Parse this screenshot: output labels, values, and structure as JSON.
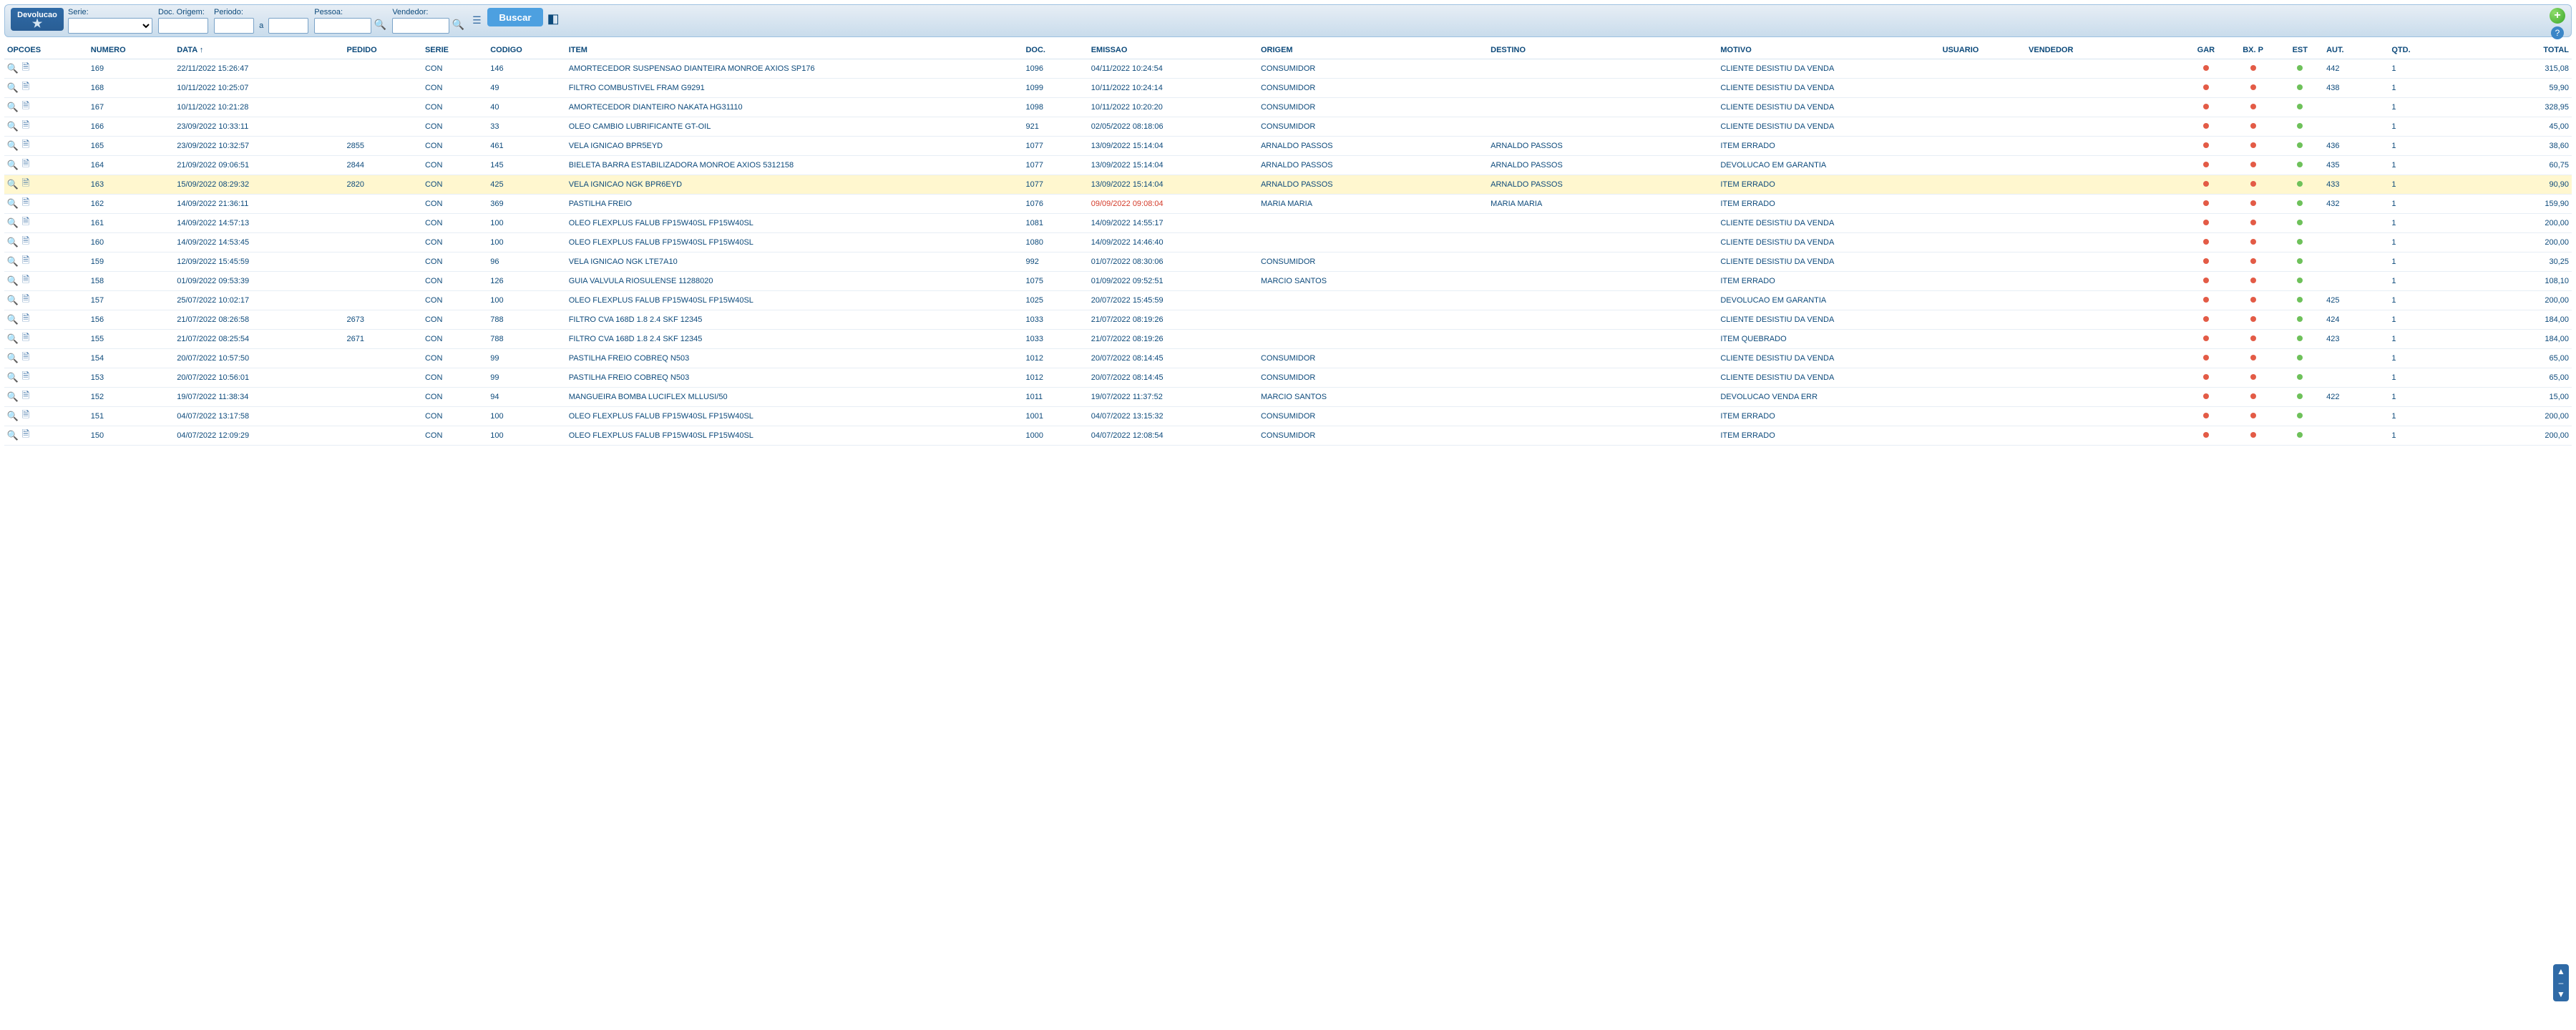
{
  "module": {
    "title": "Devolucao"
  },
  "filters": {
    "serie_label": "Serie:",
    "doc_origem_label": "Doc. Origem:",
    "periodo_label": "Periodo:",
    "periodo_sep": "a",
    "pessoa_label": "Pessoa:",
    "vendedor_label": "Vendedor:",
    "buscar_label": "Buscar"
  },
  "columns": {
    "opcoes": "OPCOES",
    "numero": "NUMERO",
    "data": "DATA ↑",
    "pedido": "PEDIDO",
    "serie": "SERIE",
    "codigo": "CODIGO",
    "item": "ITEM",
    "doc": "DOC.",
    "emissao": "EMISSAO",
    "origem": "ORIGEM",
    "destino": "DESTINO",
    "motivo": "MOTIVO",
    "usuario": "USUARIO",
    "vendedor": "VENDEDOR",
    "gar": "GAR",
    "bxp": "BX. P",
    "est": "EST",
    "aut": "AUT.",
    "qtd": "QTD.",
    "total": "TOTAL"
  },
  "rows": [
    {
      "numero": "169",
      "data": "22/11/2022 15:26:47",
      "pedido": "",
      "serie": "CON",
      "codigo": "146",
      "item": "AMORTECEDOR SUSPENSAO DIANTEIRA MONROE AXIOS SP176",
      "doc": "1096",
      "emissao": "04/11/2022 10:24:54",
      "origem": "CONSUMIDOR",
      "destino": "",
      "motivo": "CLIENTE DESISTIU DA VENDA",
      "aut": "442",
      "qtd": "1",
      "total": "315,08",
      "emissao_red": false,
      "sel": false
    },
    {
      "numero": "168",
      "data": "10/11/2022 10:25:07",
      "pedido": "",
      "serie": "CON",
      "codigo": "49",
      "item": "FILTRO COMBUSTIVEL FRAM G9291",
      "doc": "1099",
      "emissao": "10/11/2022 10:24:14",
      "origem": "CONSUMIDOR",
      "destino": "",
      "motivo": "CLIENTE DESISTIU DA VENDA",
      "aut": "438",
      "qtd": "1",
      "total": "59,90",
      "emissao_red": false,
      "sel": false
    },
    {
      "numero": "167",
      "data": "10/11/2022 10:21:28",
      "pedido": "",
      "serie": "CON",
      "codigo": "40",
      "item": "AMORTECEDOR DIANTEIRO NAKATA HG31110",
      "doc": "1098",
      "emissao": "10/11/2022 10:20:20",
      "origem": "CONSUMIDOR",
      "destino": "",
      "motivo": "CLIENTE DESISTIU DA VENDA",
      "aut": "",
      "qtd": "1",
      "total": "328,95",
      "emissao_red": false,
      "sel": false
    },
    {
      "numero": "166",
      "data": "23/09/2022 10:33:11",
      "pedido": "",
      "serie": "CON",
      "codigo": "33",
      "item": "OLEO CAMBIO LUBRIFICANTE GT-OIL",
      "doc": "921",
      "emissao": "02/05/2022 08:18:06",
      "origem": "CONSUMIDOR",
      "destino": "",
      "motivo": "CLIENTE DESISTIU DA VENDA",
      "aut": "",
      "qtd": "1",
      "total": "45,00",
      "emissao_red": false,
      "sel": false
    },
    {
      "numero": "165",
      "data": "23/09/2022 10:32:57",
      "pedido": "2855",
      "serie": "CON",
      "codigo": "461",
      "item": "VELA IGNICAO BPR5EYD",
      "doc": "1077",
      "emissao": "13/09/2022 15:14:04",
      "origem": "ARNALDO PASSOS",
      "destino": "ARNALDO PASSOS",
      "motivo": "ITEM ERRADO",
      "aut": "436",
      "qtd": "1",
      "total": "38,60",
      "emissao_red": false,
      "sel": false
    },
    {
      "numero": "164",
      "data": "21/09/2022 09:06:51",
      "pedido": "2844",
      "serie": "CON",
      "codigo": "145",
      "item": "BIELETA BARRA ESTABILIZADORA MONROE AXIOS 5312158",
      "doc": "1077",
      "emissao": "13/09/2022 15:14:04",
      "origem": "ARNALDO PASSOS",
      "destino": "ARNALDO PASSOS",
      "motivo": "DEVOLUCAO EM GARANTIA",
      "aut": "435",
      "qtd": "1",
      "total": "60,75",
      "emissao_red": false,
      "sel": false
    },
    {
      "numero": "163",
      "data": "15/09/2022 08:29:32",
      "pedido": "2820",
      "serie": "CON",
      "codigo": "425",
      "item": "VELA IGNICAO NGK BPR6EYD",
      "doc": "1077",
      "emissao": "13/09/2022 15:14:04",
      "origem": "ARNALDO PASSOS",
      "destino": "ARNALDO PASSOS",
      "motivo": "ITEM ERRADO",
      "aut": "433",
      "qtd": "1",
      "total": "90,90",
      "emissao_red": false,
      "sel": true
    },
    {
      "numero": "162",
      "data": "14/09/2022 21:36:11",
      "pedido": "",
      "serie": "CON",
      "codigo": "369",
      "item": "PASTILHA FREIO",
      "doc": "1076",
      "emissao": "09/09/2022 09:08:04",
      "origem": "MARIA MARIA",
      "destino": "MARIA MARIA",
      "motivo": "ITEM ERRADO",
      "aut": "432",
      "qtd": "1",
      "total": "159,90",
      "emissao_red": true,
      "sel": false
    },
    {
      "numero": "161",
      "data": "14/09/2022 14:57:13",
      "pedido": "",
      "serie": "CON",
      "codigo": "100",
      "item": "OLEO FLEXPLUS FALUB FP15W40SL FP15W40SL",
      "doc": "1081",
      "emissao": "14/09/2022 14:55:17",
      "origem": "",
      "destino": "",
      "motivo": "CLIENTE DESISTIU DA VENDA",
      "aut": "",
      "qtd": "1",
      "total": "200,00",
      "emissao_red": false,
      "sel": false
    },
    {
      "numero": "160",
      "data": "14/09/2022 14:53:45",
      "pedido": "",
      "serie": "CON",
      "codigo": "100",
      "item": "OLEO FLEXPLUS FALUB FP15W40SL FP15W40SL",
      "doc": "1080",
      "emissao": "14/09/2022 14:46:40",
      "origem": "",
      "destino": "",
      "motivo": "CLIENTE DESISTIU DA VENDA",
      "aut": "",
      "qtd": "1",
      "total": "200,00",
      "emissao_red": false,
      "sel": false
    },
    {
      "numero": "159",
      "data": "12/09/2022 15:45:59",
      "pedido": "",
      "serie": "CON",
      "codigo": "96",
      "item": "VELA IGNICAO NGK LTE7A10",
      "doc": "992",
      "emissao": "01/07/2022 08:30:06",
      "origem": "CONSUMIDOR",
      "destino": "",
      "motivo": "CLIENTE DESISTIU DA VENDA",
      "aut": "",
      "qtd": "1",
      "total": "30,25",
      "emissao_red": false,
      "sel": false
    },
    {
      "numero": "158",
      "data": "01/09/2022 09:53:39",
      "pedido": "",
      "serie": "CON",
      "codigo": "126",
      "item": "GUIA VALVULA RIOSULENSE 11288020",
      "doc": "1075",
      "emissao": "01/09/2022 09:52:51",
      "origem": "MARCIO SANTOS",
      "destino": "",
      "motivo": "ITEM ERRADO",
      "aut": "",
      "qtd": "1",
      "total": "108,10",
      "emissao_red": false,
      "sel": false
    },
    {
      "numero": "157",
      "data": "25/07/2022 10:02:17",
      "pedido": "",
      "serie": "CON",
      "codigo": "100",
      "item": "OLEO FLEXPLUS FALUB FP15W40SL FP15W40SL",
      "doc": "1025",
      "emissao": "20/07/2022 15:45:59",
      "origem": "",
      "destino": "",
      "motivo": "DEVOLUCAO EM GARANTIA",
      "aut": "425",
      "qtd": "1",
      "total": "200,00",
      "emissao_red": false,
      "sel": false
    },
    {
      "numero": "156",
      "data": "21/07/2022 08:26:58",
      "pedido": "2673",
      "serie": "CON",
      "codigo": "788",
      "item": "FILTRO CVA 168D 1.8 2.4 SKF 12345",
      "doc": "1033",
      "emissao": "21/07/2022 08:19:26",
      "origem": "",
      "destino": "",
      "motivo": "CLIENTE DESISTIU DA VENDA",
      "aut": "424",
      "qtd": "1",
      "total": "184,00",
      "emissao_red": false,
      "sel": false
    },
    {
      "numero": "155",
      "data": "21/07/2022 08:25:54",
      "pedido": "2671",
      "serie": "CON",
      "codigo": "788",
      "item": "FILTRO CVA 168D 1.8 2.4 SKF 12345",
      "doc": "1033",
      "emissao": "21/07/2022 08:19:26",
      "origem": "",
      "destino": "",
      "motivo": "ITEM QUEBRADO",
      "aut": "423",
      "qtd": "1",
      "total": "184,00",
      "emissao_red": false,
      "sel": false
    },
    {
      "numero": "154",
      "data": "20/07/2022 10:57:50",
      "pedido": "",
      "serie": "CON",
      "codigo": "99",
      "item": "PASTILHA FREIO COBREQ N503",
      "doc": "1012",
      "emissao": "20/07/2022 08:14:45",
      "origem": "CONSUMIDOR",
      "destino": "",
      "motivo": "CLIENTE DESISTIU DA VENDA",
      "aut": "",
      "qtd": "1",
      "total": "65,00",
      "emissao_red": false,
      "sel": false
    },
    {
      "numero": "153",
      "data": "20/07/2022 10:56:01",
      "pedido": "",
      "serie": "CON",
      "codigo": "99",
      "item": "PASTILHA FREIO COBREQ N503",
      "doc": "1012",
      "emissao": "20/07/2022 08:14:45",
      "origem": "CONSUMIDOR",
      "destino": "",
      "motivo": "CLIENTE DESISTIU DA VENDA",
      "aut": "",
      "qtd": "1",
      "total": "65,00",
      "emissao_red": false,
      "sel": false
    },
    {
      "numero": "152",
      "data": "19/07/2022 11:38:34",
      "pedido": "",
      "serie": "CON",
      "codigo": "94",
      "item": "MANGUEIRA BOMBA LUCIFLEX MLLUSI/50",
      "doc": "1011",
      "emissao": "19/07/2022 11:37:52",
      "origem": "MARCIO SANTOS",
      "destino": "",
      "motivo": "DEVOLUCAO VENDA ERR",
      "aut": "422",
      "qtd": "1",
      "total": "15,00",
      "emissao_red": false,
      "sel": false
    },
    {
      "numero": "151",
      "data": "04/07/2022 13:17:58",
      "pedido": "",
      "serie": "CON",
      "codigo": "100",
      "item": "OLEO FLEXPLUS FALUB FP15W40SL FP15W40SL",
      "doc": "1001",
      "emissao": "04/07/2022 13:15:32",
      "origem": "CONSUMIDOR",
      "destino": "",
      "motivo": "ITEM ERRADO",
      "aut": "",
      "qtd": "1",
      "total": "200,00",
      "emissao_red": false,
      "sel": false
    },
    {
      "numero": "150",
      "data": "04/07/2022 12:09:29",
      "pedido": "",
      "serie": "CON",
      "codigo": "100",
      "item": "OLEO FLEXPLUS FALUB FP15W40SL FP15W40SL",
      "doc": "1000",
      "emissao": "04/07/2022 12:08:54",
      "origem": "CONSUMIDOR",
      "destino": "",
      "motivo": "ITEM ERRADO",
      "aut": "",
      "qtd": "1",
      "total": "200,00",
      "emissao_red": false,
      "sel": false
    }
  ]
}
